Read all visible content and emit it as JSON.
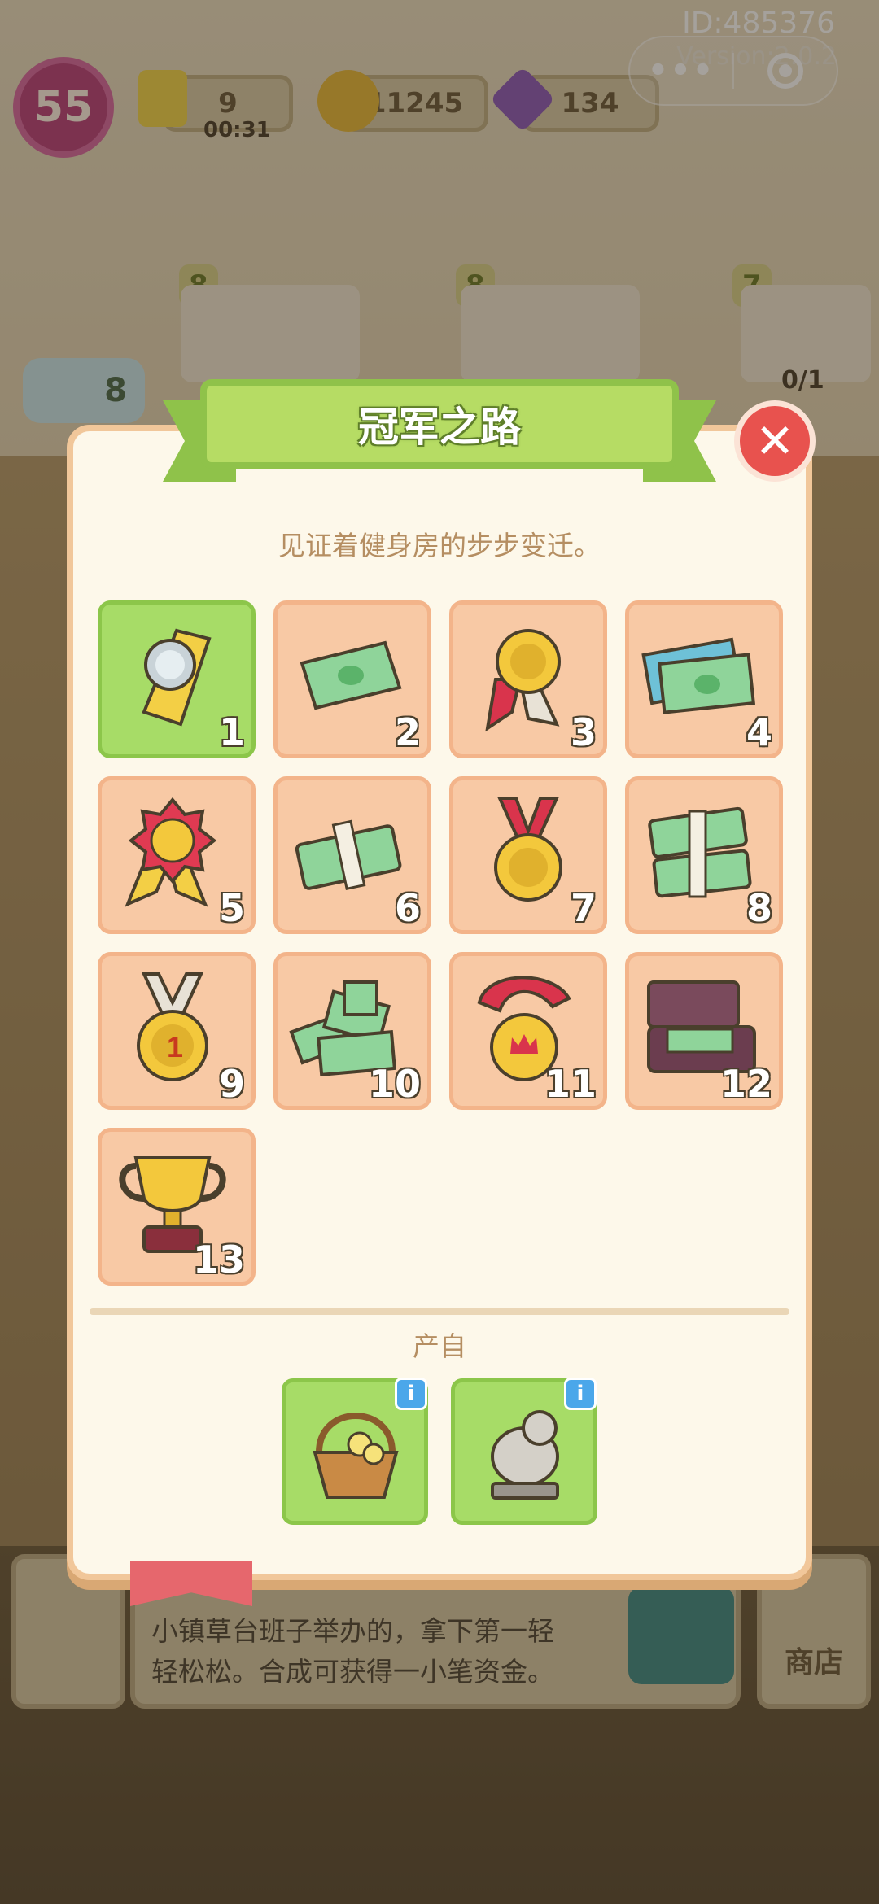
{
  "system": {
    "id_label": "ID:485376",
    "version_label": "Version:2.0.2",
    "capsule_more": "•••"
  },
  "hud": {
    "level": "55",
    "energy": "9",
    "energy_timer": "00:31",
    "coins": "11245",
    "gems": "134"
  },
  "background": {
    "tags": [
      "8",
      "8",
      "7"
    ],
    "helper_stars": "8",
    "order_progress": "0/1",
    "description_line1": "小镇草台班子举办的，拿下第一轻",
    "description_line2": "轻松松。合成可获得一小笔资金。",
    "shop_label": "商店"
  },
  "modal": {
    "title": "冠军之路",
    "subtitle": "见证着健身房的步步变迁。",
    "close_label": "✕",
    "source_title": "产自",
    "info_label": "i"
  },
  "items": [
    {
      "num": "1",
      "icon": "silver-medal-ribbon-icon",
      "unlocked": true
    },
    {
      "num": "2",
      "icon": "cash-note-icon",
      "unlocked": false
    },
    {
      "num": "3",
      "icon": "gold-ribbon-badge-icon",
      "unlocked": false
    },
    {
      "num": "4",
      "icon": "cash-pile-icon",
      "unlocked": false
    },
    {
      "num": "5",
      "icon": "rosette-medal-icon",
      "unlocked": false
    },
    {
      "num": "6",
      "icon": "cash-bundle-icon",
      "unlocked": false
    },
    {
      "num": "7",
      "icon": "gold-medal-icon",
      "unlocked": false
    },
    {
      "num": "8",
      "icon": "cash-stack-icon",
      "unlocked": false
    },
    {
      "num": "9",
      "icon": "gold-medal-1-icon",
      "unlocked": false
    },
    {
      "num": "10",
      "icon": "cash-heap-icon",
      "unlocked": false
    },
    {
      "num": "11",
      "icon": "crown-medal-icon",
      "unlocked": false
    },
    {
      "num": "12",
      "icon": "money-suitcase-icon",
      "unlocked": false
    },
    {
      "num": "13",
      "icon": "gold-trophy-icon",
      "unlocked": false
    }
  ],
  "sources": [
    {
      "icon": "flower-basket-icon"
    },
    {
      "icon": "stone-statue-icon"
    }
  ],
  "colors": {
    "unlocked_cell": "#a7dc67",
    "locked_cell": "#f8c9a5",
    "title_green": "#b6dc64",
    "close_red": "#e8524e"
  }
}
